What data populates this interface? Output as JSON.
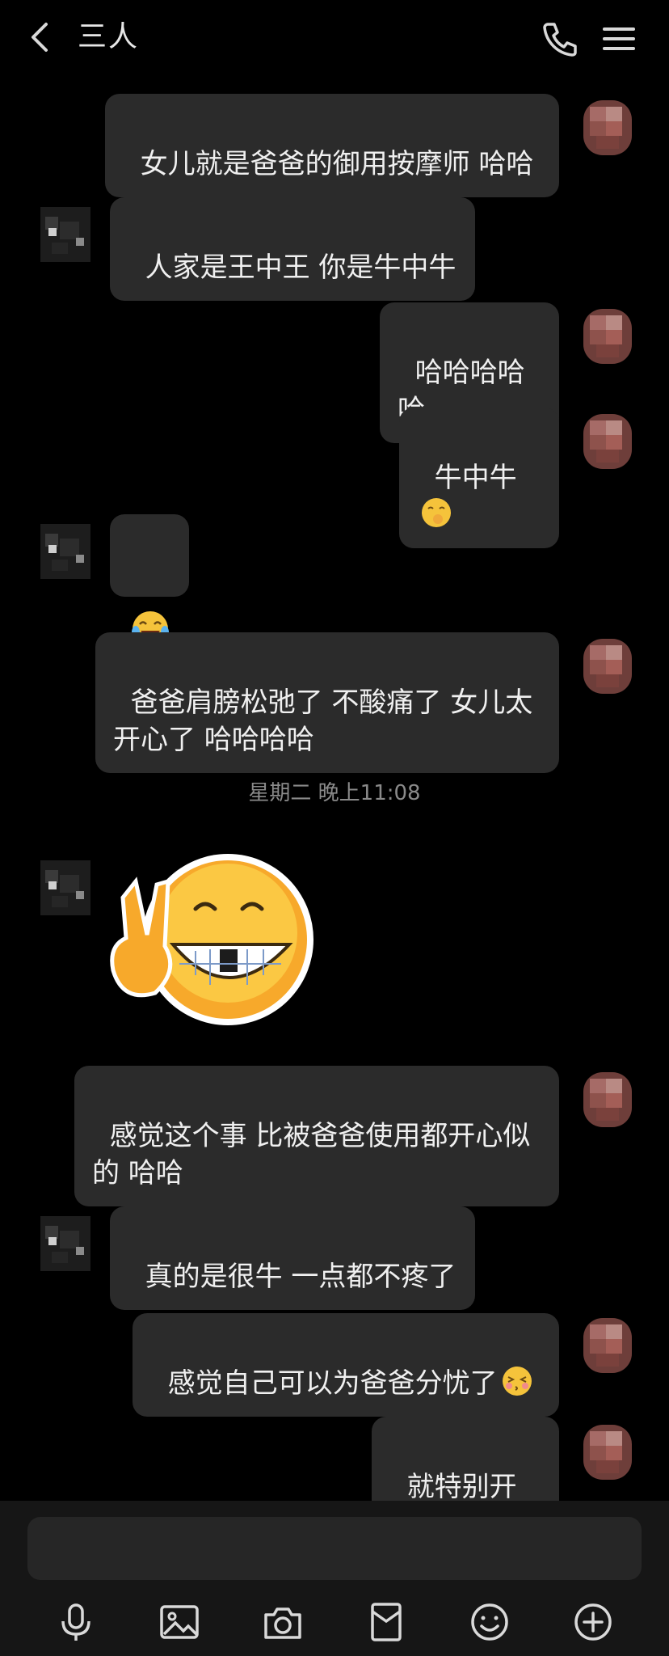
{
  "header": {
    "title": "三人",
    "back_icon": "chevron-left-icon",
    "call_icon": "phone-icon",
    "menu_icon": "hamburger-menu-icon"
  },
  "messages": [
    {
      "side": "right",
      "text": "女儿就是爸爸的御用按摩师 哈哈"
    },
    {
      "side": "left",
      "text": "人家是王中王 你是牛中牛"
    },
    {
      "side": "right",
      "text": "哈哈哈哈哈"
    },
    {
      "side": "right",
      "text": "牛中牛",
      "emoji": "giggle-emoji"
    },
    {
      "side": "left",
      "text": "",
      "emoji": "tears-of-joy-emoji"
    },
    {
      "side": "right",
      "text": "爸爸肩膀松弛了 不酸痛了 女儿太\n开心了 哈哈哈哈"
    },
    {
      "side": "left",
      "sticker": "victory-grin-sticker"
    },
    {
      "side": "right",
      "text": "感觉这个事 比被爸爸使用都开心似\n的 哈哈"
    },
    {
      "side": "left",
      "text": "真的是很牛 一点都不疼了"
    },
    {
      "side": "right",
      "text": "感觉自己可以为爸爸分忧了",
      "emoji": "kiss-emoji"
    },
    {
      "side": "right",
      "text": "就特别开心"
    }
  ],
  "timestamp": "星期二 晚上11:08",
  "input": {
    "placeholder": ""
  },
  "toolbar": {
    "items": [
      "microphone-icon",
      "image-icon",
      "camera-icon",
      "red-packet-icon",
      "smiley-icon",
      "plus-icon"
    ]
  },
  "colors": {
    "background": "#000000",
    "bubble": "#2b2b2b",
    "text": "#f0f0f0",
    "timestamp": "#8a8a8a"
  }
}
